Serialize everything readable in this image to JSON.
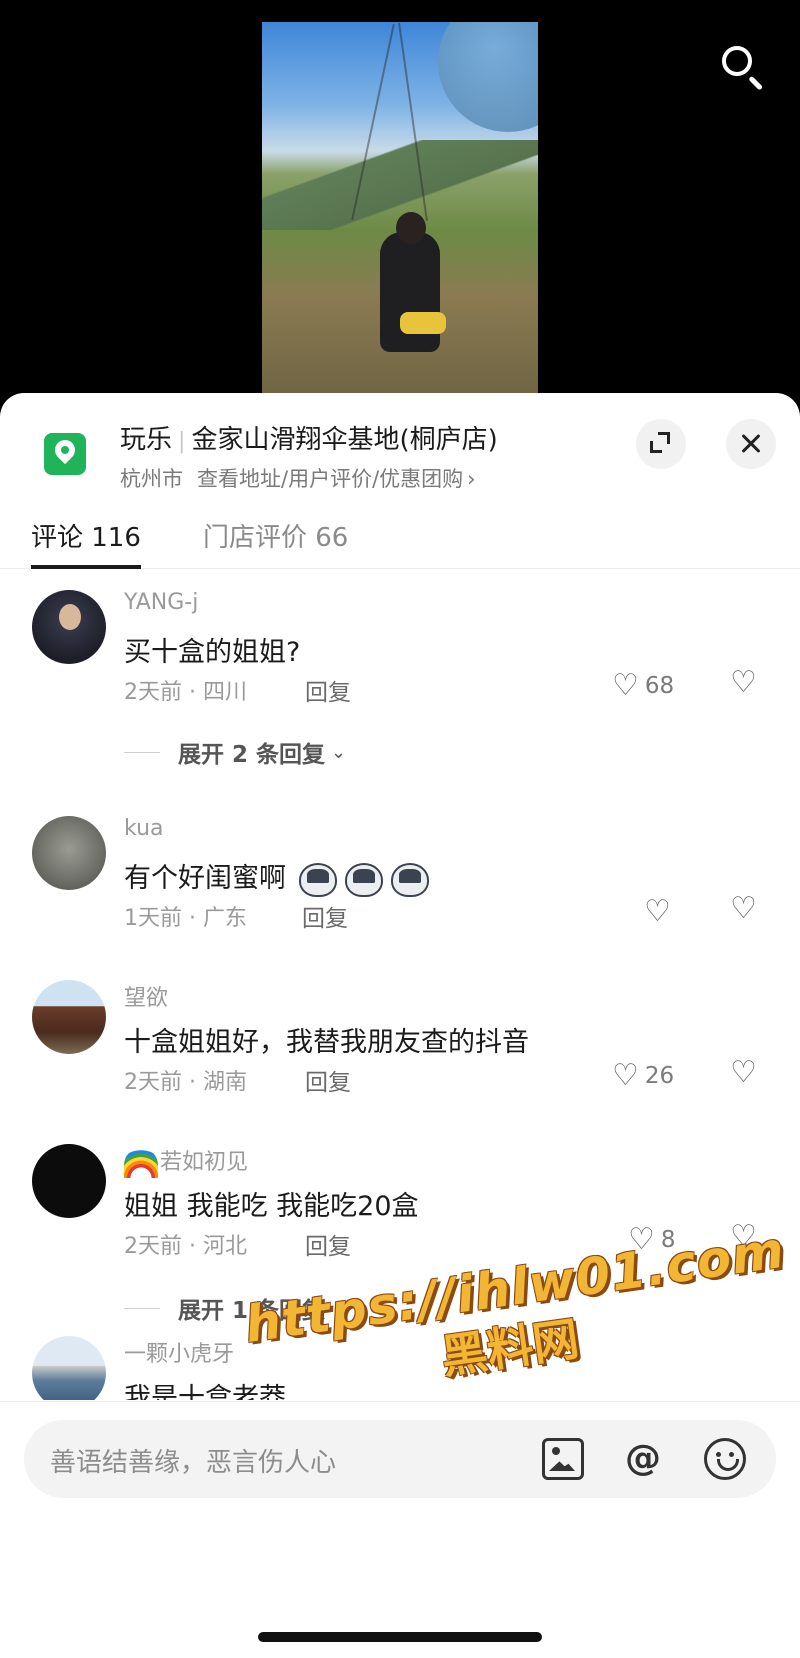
{
  "poi": {
    "category": "玩乐",
    "name": "金家山滑翔伞基地(桐庐店)",
    "city": "杭州市",
    "links": "查看地址/用户评价/优惠团购",
    "chevron": "›"
  },
  "tabs": [
    {
      "label": "评论 116"
    },
    {
      "label": "门店评价 66"
    }
  ],
  "comments": [
    {
      "username": "YANG-j",
      "text": "买十盒的姐姐?",
      "meta": "2天前 · 四川",
      "reply": "回复",
      "likes": "68"
    },
    {
      "username": "kua",
      "text": "有个好闺蜜啊",
      "emoji_icons": [
        "wolf-emoji",
        "wolf-emoji",
        "wolf-emoji"
      ],
      "meta": "1天前 · 广东",
      "reply": "回复",
      "likes": ""
    },
    {
      "username": "望欲",
      "text": "十盒姐姐好，我替我朋友查的抖音",
      "meta": "2天前 · 湖南",
      "reply": "回复",
      "likes": "26"
    },
    {
      "username": "若如初见",
      "username_prefix_icon": "rainbow-emoji",
      "text": "姐姐  我能吃 我能吃20盒",
      "meta": "2天前 · 河北",
      "reply": "回复",
      "likes": "8"
    },
    {
      "username": "一颗小虎牙",
      "text": "我是十盒老莽"
    }
  ],
  "expand_replies": [
    {
      "label": "展开 2 条回复",
      "chevron": "⌄"
    },
    {
      "label": "展开 1 条回复",
      "chevron": "⌄"
    }
  ],
  "input": {
    "placeholder": "善语结善缘，恶言伤人心"
  },
  "watermark": {
    "url": "https://ihlw01.com",
    "name": "黑料网"
  },
  "icons": {
    "heart": "♡",
    "dislike": "♡",
    "at": "@"
  }
}
